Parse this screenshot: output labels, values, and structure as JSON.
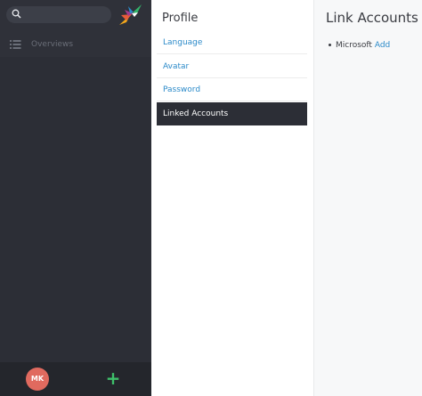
{
  "sidebar": {
    "search": {
      "value": "",
      "icon": "search-icon"
    },
    "nav": [
      {
        "label": "Overviews",
        "icon": "list-icon"
      }
    ],
    "footer": {
      "avatar_initials": "MK",
      "add_label": "+"
    }
  },
  "profile": {
    "title": "Profile",
    "items": [
      {
        "label": "Language"
      },
      {
        "label": "Avatar"
      },
      {
        "label": "Password"
      },
      {
        "label": "Linked Accounts"
      }
    ],
    "active_item": "Linked Accounts"
  },
  "linked_accounts": {
    "title": "Link Accounts",
    "accounts": [
      {
        "name": "Microsoft",
        "action_label": "Add"
      }
    ]
  },
  "colors": {
    "sidebar_bg": "#2c2e36",
    "link": "#2b8ac9",
    "avatar_bg": "#e06a5f",
    "add_green": "#3ec06a"
  }
}
